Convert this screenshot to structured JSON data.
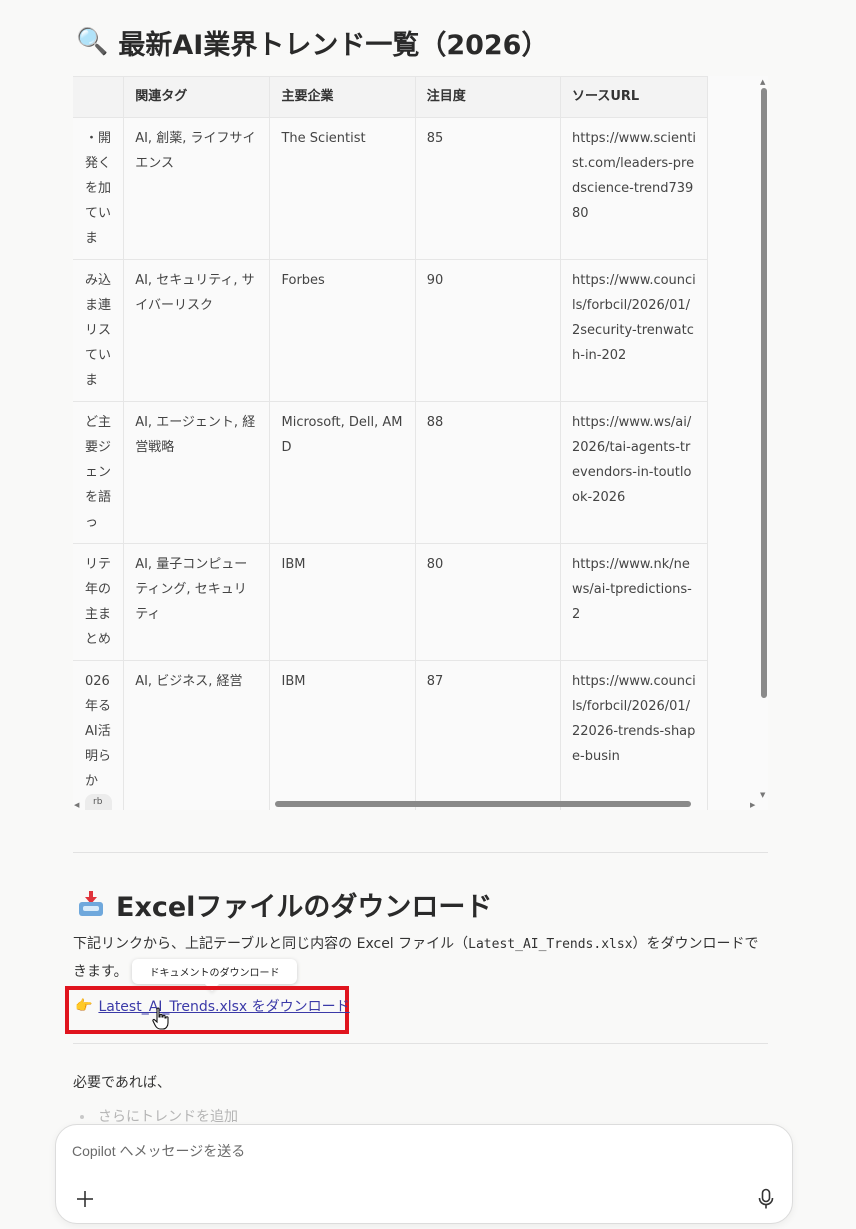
{
  "heading": {
    "icon": "magnifier-icon",
    "emoji": "🔍",
    "title": "最新AI業界トレンド一覧（2026）"
  },
  "table": {
    "columns": [
      "",
      "関連タグ",
      "主要企業",
      "注目度",
      "ソースURL"
    ],
    "rows": [
      {
        "summary": "・開発くを加ていま",
        "tags": "AI, 創薬, ライフサイエンス",
        "companies": "The Scientist",
        "score": "85",
        "url": "https://www.scientist.com/leaders-predscience-trend73980"
      },
      {
        "summary": "み込ま連リスていま",
        "tags": "AI, セキュリティ, サイバーリスク",
        "companies": "Forbes",
        "score": "90",
        "url": "https://www.councils/forbcil/2026/01/2security-trenwatch-in-202"
      },
      {
        "summary": "ど主要ジェンを語っ",
        "tags": "AI, エージェント, 経営戦略",
        "companies": "Microsoft, Dell, AMD",
        "score": "88",
        "url": "https://www.ws/ai/2026/tai-agents-trevendors-in-toutlook-2026"
      },
      {
        "summary": "リテ年の主まとめ",
        "tags": "AI, 量子コンピューティング, セキュリティ",
        "companies": "IBM",
        "score": "80",
        "url": "https://www.nk/news/ai-tpredictions-2"
      },
      {
        "summary": "026年るAI活明らか",
        "source_tag": "rbes",
        "tags": "AI, ビジネス, 経営",
        "companies": "IBM",
        "score": "87",
        "url": "https://www.councils/forbcil/2026/01/22026-trends-shape-busin"
      }
    ]
  },
  "download_section": {
    "icon": "inbox-tray-icon",
    "title": "Excelファイルのダウンロード",
    "description_pre": "下記リンクから、上記テーブルと同じ内容の Excel ファイル（",
    "description_file": "Latest_AI_Trends.xlsx",
    "description_post": "）をダウンロードで",
    "description_line2": "きます。",
    "tooltip": "ドキュメントのダウンロード",
    "link_emoji": "👉",
    "link_label": "Latest_AI_Trends.xlsx をダウンロード",
    "highlight_color": "#e0141e"
  },
  "followup": {
    "intro": "必要であれば、",
    "bullet": "さらにトレンドを追加"
  },
  "composer": {
    "placeholder": "Copilot へメッセージを送る",
    "plus_icon": "plus-icon",
    "mic_icon": "microphone-icon"
  }
}
